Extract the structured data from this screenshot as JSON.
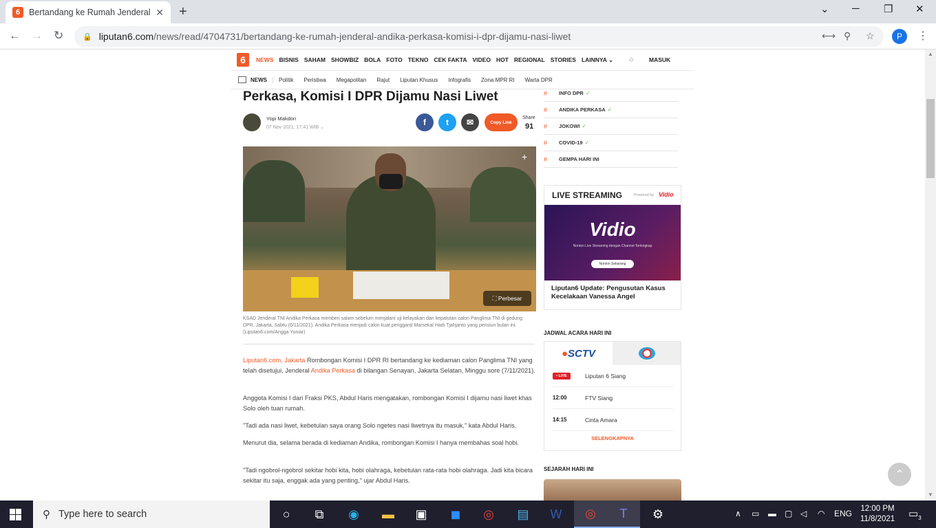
{
  "browser": {
    "tab_title": "Bertandang ke Rumah Jenderal Andika Perkasa",
    "tab_favicon": "6",
    "new_tab": "+",
    "url_domain": "liputan6.com",
    "url_path": "/news/read/4704731/bertandang-ke-rumah-jenderal-andika-perkasa-komisi-i-dpr-dijamu-nasi-liwet",
    "profile_initial": "P"
  },
  "site": {
    "logo": "6",
    "nav": [
      "NEWS",
      "BISNIS",
      "SAHAM",
      "SHOWBIZ",
      "BOLA",
      "FOTO",
      "TEKNO",
      "CEK FAKTA",
      "VIDEO",
      "HOT",
      "REGIONAL",
      "STORIES",
      "LAINNYA ⌄"
    ],
    "login": "MASUK",
    "subnav_head": "NEWS",
    "subnav": [
      "Politik",
      "Peristiwa",
      "Megapolitan",
      "Rajut",
      "Liputan Khusus",
      "Infografis",
      "Zona MPR RI",
      "Warta DPR"
    ]
  },
  "article": {
    "headline": "Perkasa, Komisi I DPR Dijamu Nasi Liwet",
    "author": "Yopi Makdori",
    "date": "07 Nov 2021, 17:41 WIB ⌄",
    "copy_link": "Copy Link",
    "share_label": "Share",
    "share_count": "91",
    "zoom_label": "Perbesar",
    "caption": "KSAD Jenderal TNI Andika Perkasa memberi salam sebelum menjalani uji kelayakan dan kepatutan calon Panglima TNI di gedung DPR, Jakarta, Sabtu (6/11/2021). Andika Perkasa menjadi calon kuat pengganti Marsekal Hadi Tjahjanto yang pensiun bulan ini. (Liputan6.com/Angga Yuniar)",
    "p1_source": "Liputan6.com, Jakarta",
    "p1_a": " Rombongan Komisi I DPR RI bertandang ke kediaman calon Panglima TNI yang telah disetujui, Jenderal ",
    "p1_link": "Andika Perkasa",
    "p1_b": " di bilangan Senayan, Jakarta Selatan, Minggu sore (7/11/2021).",
    "p2": "Anggota Komisi I dari Fraksi PKS, Abdul Haris mengatakan, rombongan Komisi I dijamu nasi liwet khas Solo oleh tuan rumah.",
    "p3": "\"Tadi ada nasi liwet, kebetulan saya orang Solo ngetes nasi liwetnya itu masuk,\" kata Abdul Haris.",
    "p4": "Menurut dia, selama berada di kediaman Andika, rombongan Komisi I hanya membahas soal hobi.",
    "p5": "\"Tadi ngobrol-ngobrol sekitar hobi kita, hobi olahraga, kebetulan rata-rata hobi olahraga. Jadi kita bicara sekitar itu saja, enggak ada yang penting,\" ujar Abdul Haris."
  },
  "sidebar": {
    "tags": [
      "INFO DPR",
      "ANDIKA PERKASA",
      "JOKOWI",
      "COVID-19",
      "GEMPA HARI INI"
    ],
    "live_title": "LIVE STREAMING",
    "powered_by": "Powered by",
    "vidio_small": "Vidio",
    "vidio_logo": "Vidio",
    "vidio_sub": "Nonton Live Streaming dengan Channel Terlengkap",
    "vidio_btn": "Nonton Sekarang",
    "live_caption": "Liputan6 Update: Pengusutan Kasus Kecelakaan Vanessa Angel",
    "jadwal_title": "JADWAL ACARA HARI INI",
    "sctv": "SCTV",
    "schedule": [
      {
        "time": "LIVE",
        "program": "Liputan 6 Siang"
      },
      {
        "time": "12:00",
        "program": "FTV Siang"
      },
      {
        "time": "14:15",
        "program": "Cinta Amara"
      }
    ],
    "more": "SELENGKAPNYA",
    "sejarah_title": "SEJARAH HARI INI"
  },
  "taskbar": {
    "search_placeholder": "Type here to search",
    "lang": "ENG",
    "time": "12:00 PM",
    "date": "11/8/2021",
    "notif_count": "3"
  }
}
